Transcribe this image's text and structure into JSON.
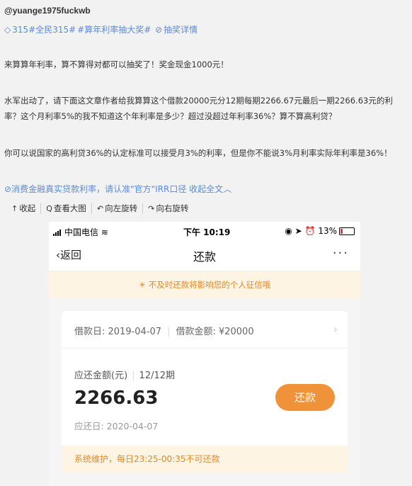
{
  "post": {
    "author": "@yuange1975fuckwb",
    "tags": [
      "315#全民315#",
      "#算年利率抽大奖#",
      "抽奖详情"
    ],
    "paragraph1": "来算算年利率，算不算得对都可以抽奖了！奖金现金1000元！",
    "paragraph2": "水军出动了，请下面这文章作者给我算算这个借款20000元分12期每期2266.67元最后一期2266.63元的利率？这个月利率5%的我不知道这个年利率是多少？超过没超过年利率36%？算不算高利贷？",
    "paragraph3": "你可以说国家的高利贷36%的认定标准可以接受月3%的利率，但是你不能说3%月利率实际年利率是36%！",
    "link": "消费金融真实贷款利率，请认准\"官方\"IRR口径 收起全文",
    "toolbar": {
      "collapse": "收起",
      "view_large": "查看大图",
      "rotate_left": "向左旋转",
      "rotate_right": "向右旋转"
    }
  },
  "phone": {
    "status": {
      "carrier": "中国电信",
      "time": "下午 10:19",
      "battery": "13%"
    },
    "nav": {
      "back": "返回",
      "title": "还款",
      "more": "···"
    },
    "notice": "不及时还款将影响您的个人征信哦",
    "card": {
      "loan_date": "借款日: 2019-04-07",
      "loan_amount": "借款金额: ¥20000",
      "due_label": "应还金额(元)",
      "period": "12/12期",
      "amount": "2266.63",
      "due_date": "应还日: 2020-04-07",
      "repay_button": "还款",
      "maintenance": "系统维护，每日23:25-00:35不可还款"
    },
    "colors": {
      "accent": "#f0923a",
      "notice_bg": "#fdf4e3",
      "link": "#5a8bd8"
    }
  }
}
